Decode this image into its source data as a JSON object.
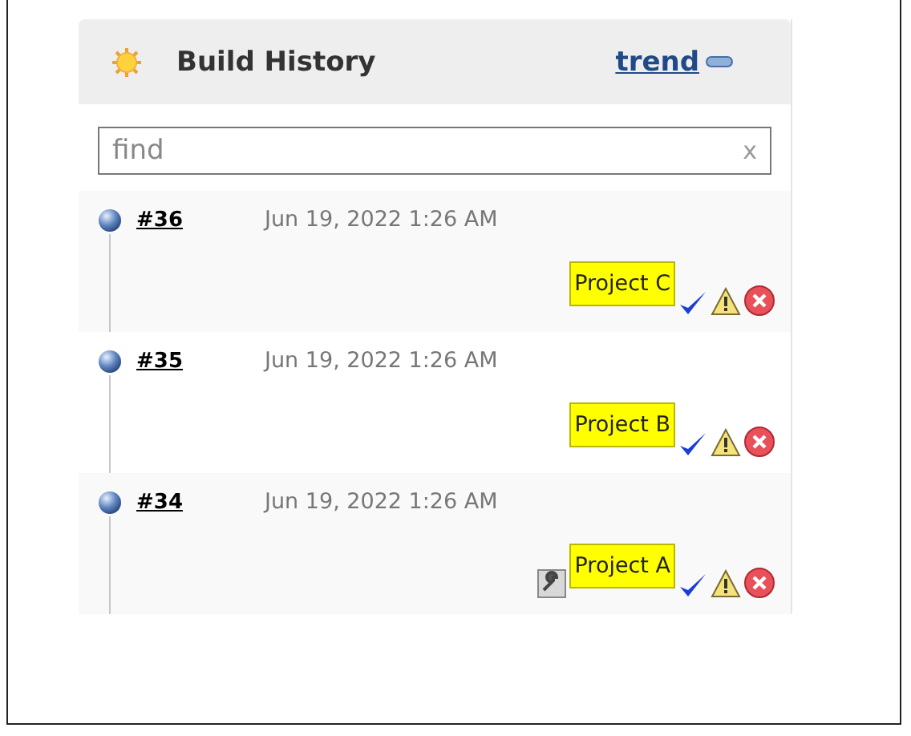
{
  "panel": {
    "title": "Build History",
    "trend_link": "trend"
  },
  "search": {
    "placeholder": "find",
    "clear": "x"
  },
  "builds": [
    {
      "number": "#36",
      "time": "Jun 19, 2022 1:26 AM",
      "label": "Project C",
      "tool_icon": false
    },
    {
      "number": "#35",
      "time": "Jun 19, 2022 1:26 AM",
      "label": "Project B",
      "tool_icon": false
    },
    {
      "number": "#34",
      "time": "Jun 19, 2022 1:26 AM",
      "label": "Project A",
      "tool_icon": true
    }
  ]
}
